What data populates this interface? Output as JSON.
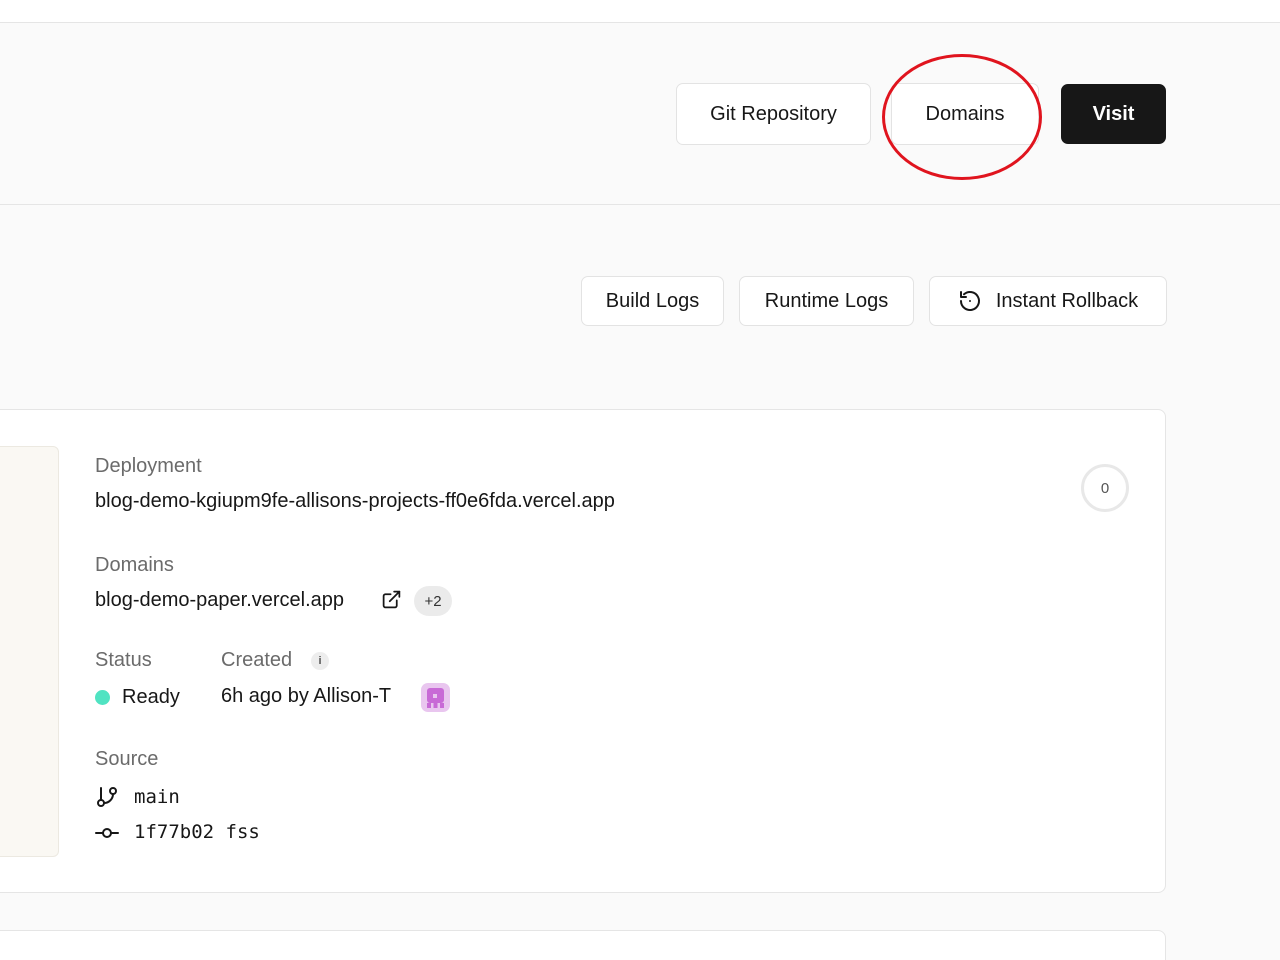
{
  "header": {
    "git_repository_label": "Git Repository",
    "domains_label": "Domains",
    "visit_label": "Visit"
  },
  "toolbar": {
    "build_logs_label": "Build Logs",
    "runtime_logs_label": "Runtime Logs",
    "instant_rollback_label": "Instant Rollback"
  },
  "deployment": {
    "deployment_label": "Deployment",
    "deployment_url": "blog-demo-kgiupm9fe-allisons-projects-ff0e6fda.vercel.app",
    "domains_label": "Domains",
    "domain_url": "blog-demo-paper.vercel.app",
    "domains_extra_count": "+2",
    "status_label": "Status",
    "status_value": "Ready",
    "created_label": "Created",
    "created_value": "6h ago by Allison-T",
    "source_label": "Source",
    "branch": "main",
    "commit": "1f77b02 fss",
    "counter": "0"
  },
  "colors": {
    "status_ready": "#50e3c2",
    "highlight_ring": "#e0141e",
    "avatar": "#c86ad6",
    "primary_button": "#171717"
  },
  "icons": {
    "rollback": "rollback-icon",
    "external_link": "external-link-icon",
    "info": "info-icon",
    "branch": "git-branch-icon",
    "commit": "git-commit-icon"
  }
}
